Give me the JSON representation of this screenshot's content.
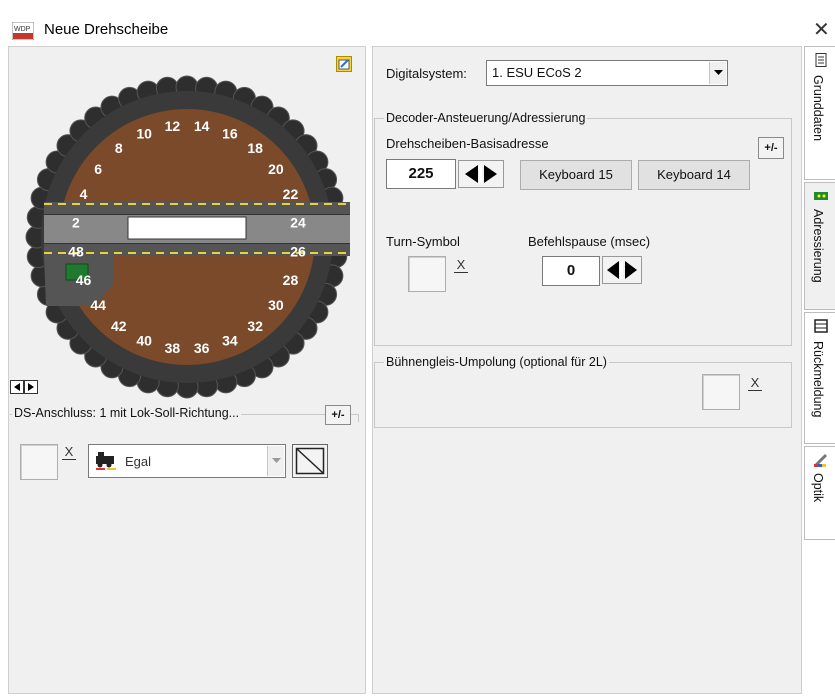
{
  "window": {
    "title": "Neue Drehscheibe",
    "close_glyph": "✕",
    "app_icon": "wdp-icon"
  },
  "turntable": {
    "track_labels": [
      "2",
      "4",
      "6",
      "8",
      "10",
      "12",
      "14",
      "16",
      "18",
      "20",
      "22",
      "24",
      "26",
      "28",
      "30",
      "32",
      "34",
      "36",
      "38",
      "40",
      "42",
      "44",
      "46",
      "48"
    ],
    "colors": {
      "ring": "#3a3a3a",
      "pit": "#7a4a2a",
      "bridge": "#555555",
      "rail_stripe": "#e8d23a",
      "cabin": "#1f7a2f"
    }
  },
  "left": {
    "ds_group_label": "DS-Anschluss: 1 mit Lok-Soll-Richtung...",
    "plus_minus_label": "+/-",
    "direction_combo_value": "Egal",
    "x_glyph": "X"
  },
  "right": {
    "digital_label": "Digitalsystem:",
    "digital_value": "1. ESU ECoS 2",
    "decoder_group_label": "Decoder-Ansteuerung/Adressierung",
    "base_addr_label": "Drehscheiben-Basisadresse",
    "plus_minus_label": "+/-",
    "base_addr_value": "225",
    "keyboard1_label": "Keyboard 15",
    "keyboard2_label": "Keyboard 14",
    "turn_symbol_label": "Turn-Symbol",
    "befehl_label": "Befehlspause (msec)",
    "befehl_value": "0",
    "x_glyph": "X",
    "umpolung_group_label": "Bühnengleis-Umpolung (optional für 2L)"
  },
  "tabs": [
    {
      "label": "Grunddaten",
      "icon": "document-icon"
    },
    {
      "label": "Adressierung",
      "icon": "decoder-chip-icon"
    },
    {
      "label": "Rückmeldung",
      "icon": "track-contact-icon"
    },
    {
      "label": "Optik",
      "icon": "paint-brush-icon"
    }
  ]
}
